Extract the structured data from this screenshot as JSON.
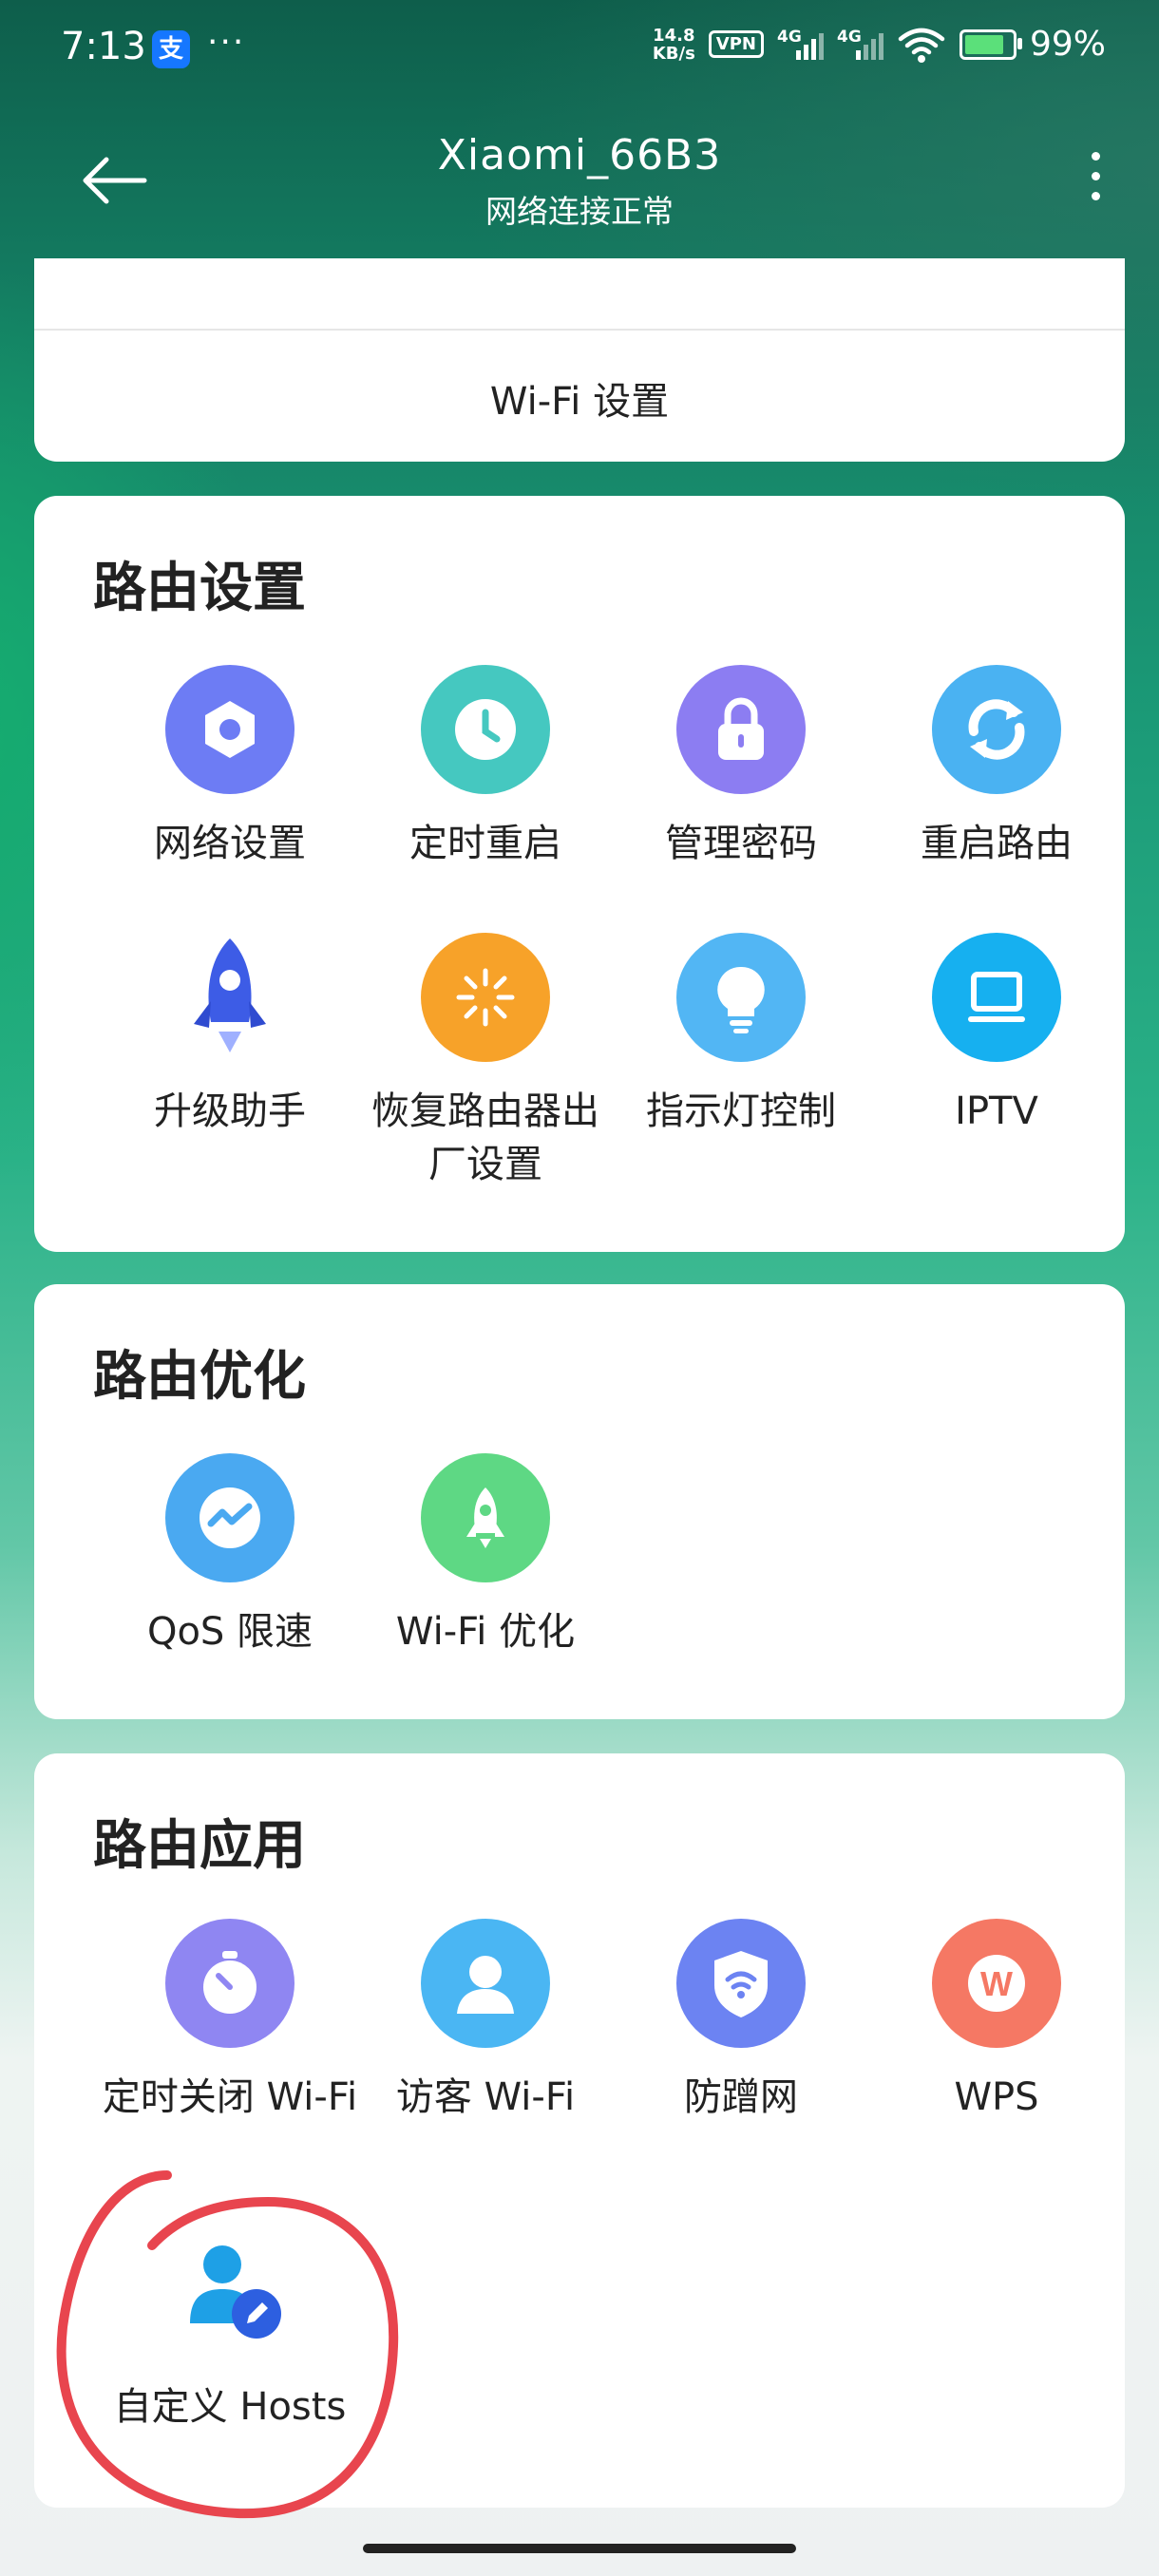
{
  "status_bar": {
    "time": "7:13",
    "alipay_glyph": "支",
    "more_dots": "···",
    "net_speed_value": "14.8",
    "net_speed_unit": "KB/s",
    "vpn": "VPN",
    "sim1_type": "4G",
    "sim2_type": "4G",
    "battery": "99%"
  },
  "header": {
    "title": "Xiaomi_66B3",
    "subtitle": "网络连接正常"
  },
  "wifi_card": {
    "wifi_settings_label": "Wi-Fi 设置"
  },
  "router_settings": {
    "title": "路由设置",
    "items": [
      {
        "label": "网络设置",
        "icon": "hexagon-nut-icon",
        "color": "#6d7cf4"
      },
      {
        "label": "定时重启",
        "icon": "clock-icon",
        "color": "#45c8c0"
      },
      {
        "label": "管理密码",
        "icon": "lock-icon",
        "color": "#8c7df2"
      },
      {
        "label": "重启路由",
        "icon": "refresh-icon",
        "color": "#4ab2f2"
      },
      {
        "label": "升级助手",
        "icon": "rocket-icon",
        "color": "#3d5ce6"
      },
      {
        "label": "恢复路由器出厂设置",
        "icon": "sunburst-icon",
        "color": "#f7a229"
      },
      {
        "label": "指示灯控制",
        "icon": "lightbulb-icon",
        "color": "#52b6f4"
      },
      {
        "label": "IPTV",
        "icon": "monitor-icon",
        "color": "#16b0f0"
      }
    ]
  },
  "router_optimization": {
    "title": "路由优化",
    "items": [
      {
        "label": "QoS 限速",
        "icon": "speed-wave-icon",
        "color": "#4aa9f1"
      },
      {
        "label": "Wi-Fi 优化",
        "icon": "rocket-icon",
        "color": "#5ed884"
      }
    ]
  },
  "router_apps": {
    "title": "路由应用",
    "items": [
      {
        "label": "定时关闭 Wi-Fi",
        "icon": "stopwatch-icon",
        "color": "#8f86f2"
      },
      {
        "label": "访客 Wi-Fi",
        "icon": "guest-user-icon",
        "color": "#4ab6f3"
      },
      {
        "label": "防蹭网",
        "icon": "wifi-shield-icon",
        "color": "#6c83f2"
      },
      {
        "label": "WPS",
        "icon": "wps-icon",
        "color": "#f57864",
        "glyph": "W"
      },
      {
        "label": "自定义 Hosts",
        "icon": "user-edit-icon",
        "color": "#2e8ff0"
      }
    ]
  }
}
